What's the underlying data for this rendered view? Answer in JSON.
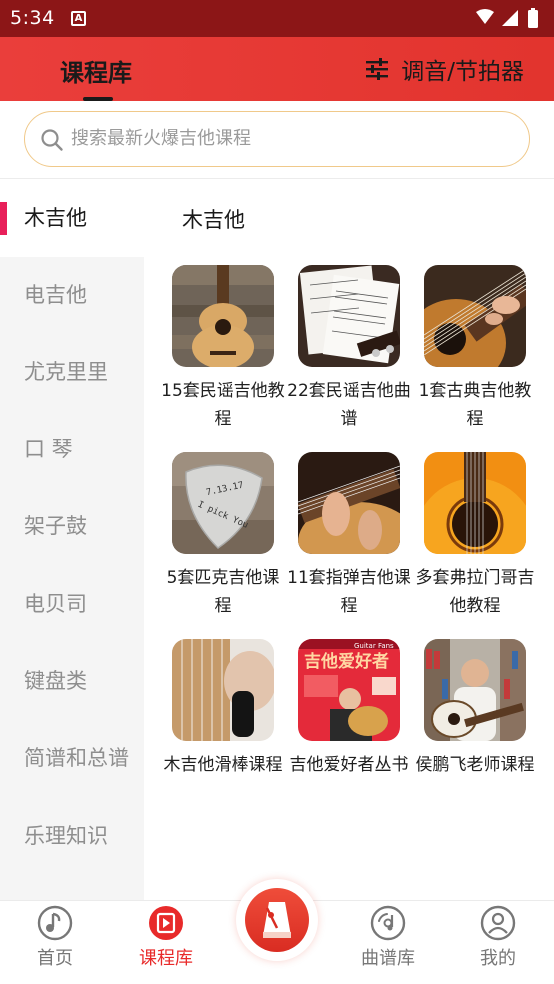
{
  "status_bar": {
    "time": "5:34",
    "notif_letter": "A"
  },
  "header": {
    "title": "课程库",
    "tuner_label": "调音/节拍器"
  },
  "search": {
    "placeholder": "搜索最新火爆吉他课程"
  },
  "sidebar": {
    "items": [
      {
        "label": "木吉他",
        "active": true
      },
      {
        "label": "电吉他"
      },
      {
        "label": "尤克里里"
      },
      {
        "label": "口 琴"
      },
      {
        "label": "架子鼓"
      },
      {
        "label": "电贝司"
      },
      {
        "label": "键盘类"
      },
      {
        "label": "简谱和总谱"
      },
      {
        "label": "乐理知识"
      }
    ]
  },
  "main": {
    "section_title": "木吉他",
    "cards": [
      {
        "label": "15套民谣吉他教程"
      },
      {
        "label": "22套民谣吉他曲谱"
      },
      {
        "label": "1套古典吉他教程"
      },
      {
        "label": "5套匹克吉他课程"
      },
      {
        "label": "11套指弹吉他课程"
      },
      {
        "label": "多套弗拉门哥吉他教程"
      },
      {
        "label": "木吉他滑棒课程"
      },
      {
        "label": "吉他爱好者丛书"
      },
      {
        "label": "侯鹏飞老师课程"
      }
    ],
    "thumb_texts": {
      "pick_line1": "7.13.17",
      "pick_line2": "I pick You",
      "book_badge": "Guitar Fans",
      "book_title": "吉他爱好者"
    }
  },
  "bottom_nav": {
    "items": [
      {
        "label": "首页",
        "icon": "music-note-circle-icon"
      },
      {
        "label": "课程库",
        "icon": "play-book-icon",
        "active": true
      },
      {
        "label": "",
        "icon": "metronome-icon"
      },
      {
        "label": "曲谱库",
        "icon": "vinyl-disc-icon"
      },
      {
        "label": "我的",
        "icon": "user-icon"
      }
    ]
  },
  "colors": {
    "status_bar": "#8c1617",
    "header": "#e63a36",
    "accent": "#e82a2a",
    "indicator": "#e8205a",
    "search_border": "#f0c98a"
  }
}
